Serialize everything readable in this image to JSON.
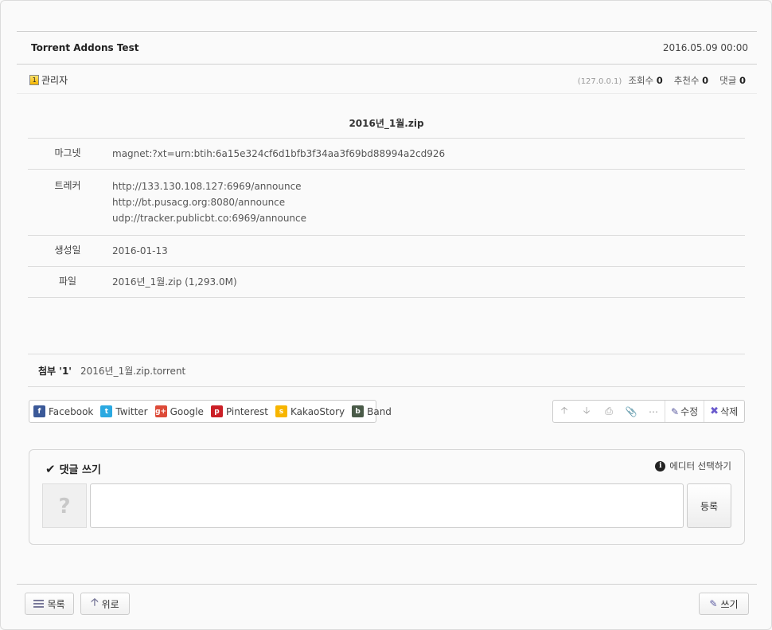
{
  "post": {
    "title": "Torrent Addons Test",
    "date": "2016.05.09 00:00",
    "author": "관리자",
    "author_level": "1",
    "ip": "(127.0.0.1)",
    "views_label": "조회수",
    "views": "0",
    "recommend_label": "추천수",
    "recommend": "0",
    "comments_label": "댓글",
    "comments": "0"
  },
  "torrent": {
    "name": "2016년_1월.zip",
    "rows": [
      {
        "label": "마그넷",
        "values": [
          "magnet:?xt=urn:btih:6a15e324cf6d1bfb3f34aa3f69bd88994a2cd926"
        ]
      },
      {
        "label": "트레커",
        "values": [
          "http://133.130.108.127:6969/announce",
          "http://bt.pusacg.org:8080/announce",
          "udp://tracker.publicbt.co:6969/announce"
        ]
      },
      {
        "label": "생성일",
        "values": [
          "2016-01-13"
        ]
      },
      {
        "label": "파일",
        "values": [
          "2016년_1월.zip (1,293.0M)"
        ]
      }
    ]
  },
  "attachment": {
    "label": "첨부 '",
    "count": "1",
    "close": "'",
    "file": "2016년_1월.zip.torrent"
  },
  "share": [
    {
      "label": "Facebook",
      "icon": "facebook-icon",
      "color": "#3b5998",
      "glyph": "f"
    },
    {
      "label": "Twitter",
      "icon": "twitter-icon",
      "color": "#2ba9e1",
      "glyph": "t"
    },
    {
      "label": "Google",
      "icon": "google-plus-icon",
      "color": "#dd4b39",
      "glyph": "g+"
    },
    {
      "label": "Pinterest",
      "icon": "pinterest-icon",
      "color": "#cb2027",
      "glyph": "p"
    },
    {
      "label": "KakaoStory",
      "icon": "kakaostory-icon",
      "color": "#f7b500",
      "glyph": "s"
    },
    {
      "label": "Band",
      "icon": "band-icon",
      "color": "#4a5b49",
      "glyph": "b"
    }
  ],
  "tools": {
    "edit": "수정",
    "delete": "삭제"
  },
  "comment": {
    "title": "댓글 쓰기",
    "editor_select": "에디터 선택하기",
    "avatar": "?",
    "submit": "등록",
    "text": ""
  },
  "footer": {
    "list": "목록",
    "top": "위로",
    "write": "쓰기"
  }
}
